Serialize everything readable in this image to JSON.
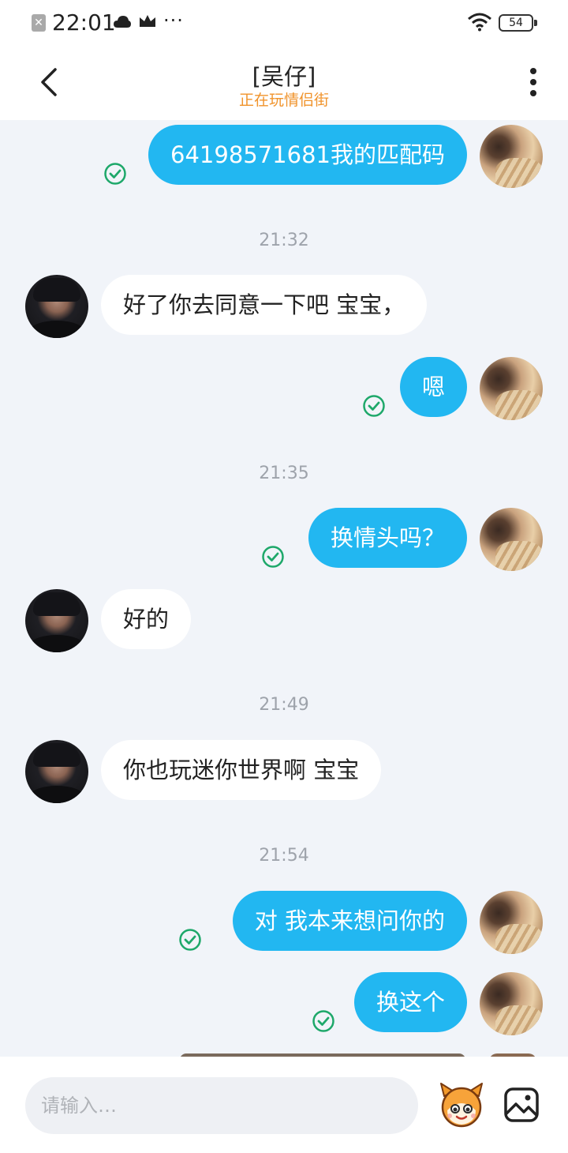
{
  "status_bar": {
    "time": "22:01",
    "battery": "54",
    "icons": [
      "notification-blocked-icon",
      "cloud-icon",
      "crown-icon",
      "more-dots-icon",
      "wifi-icon",
      "battery-icon"
    ],
    "dots": "···"
  },
  "header": {
    "title": "[吴仔]",
    "subtitle": "正在玩情侣街",
    "subtitle_color": "#f0932b"
  },
  "colors": {
    "my_bubble": "#22b7f1",
    "their_bubble": "#ffffff",
    "background": "#f1f4f9",
    "check_green": "#1ea86a"
  },
  "messages": [
    {
      "type": "bubble",
      "sender": "me",
      "text": "64198571681我的匹配码",
      "status": "read"
    },
    {
      "type": "time",
      "text": "21:32"
    },
    {
      "type": "bubble",
      "sender": "other",
      "text": "好了你去同意一下吧 宝宝，"
    },
    {
      "type": "bubble",
      "sender": "me",
      "text": "嗯",
      "status": "read"
    },
    {
      "type": "time",
      "text": "21:35"
    },
    {
      "type": "bubble",
      "sender": "me",
      "text": "换情头吗？",
      "status": "read"
    },
    {
      "type": "bubble",
      "sender": "other",
      "text": "好的"
    },
    {
      "type": "time",
      "text": "21:49"
    },
    {
      "type": "bubble",
      "sender": "other",
      "text": "你也玩迷你世界啊 宝宝"
    },
    {
      "type": "time",
      "text": "21:54"
    },
    {
      "type": "bubble",
      "sender": "me",
      "text": "对 我本来想问你的",
      "status": "read"
    },
    {
      "type": "bubble",
      "sender": "me",
      "text": "换这个",
      "status": "read"
    }
  ],
  "input": {
    "placeholder": "请输入…"
  }
}
